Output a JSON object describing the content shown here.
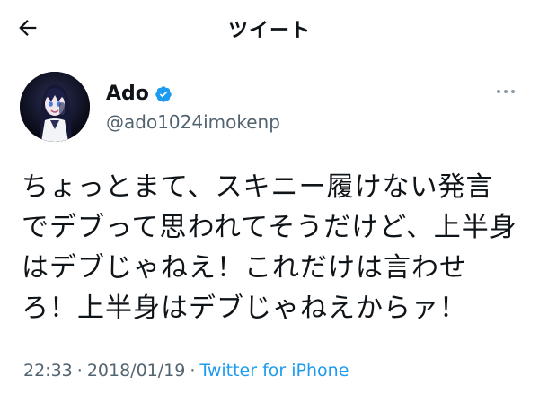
{
  "header": {
    "title": "ツイート",
    "back_icon": "arrow-left-icon"
  },
  "author": {
    "display_name": "Ado",
    "handle": "@ado1024imokenp",
    "verified": true,
    "verified_color": "#1d9bf0",
    "more_icon": "more-horizontal-icon"
  },
  "tweet": {
    "text": "ちょっとまて、スキニー履けない発言でデブって思われてそうだけど、上半身はデブじゃねえ！これだけは言わせろ！上半身はデブじゃねえからァ！",
    "time": "22:33",
    "date": "2018/01/19",
    "source": "Twitter for iPhone",
    "separator": "·"
  },
  "colors": {
    "text": "#0f1419",
    "secondary": "#536471",
    "link": "#1d9bf0"
  }
}
